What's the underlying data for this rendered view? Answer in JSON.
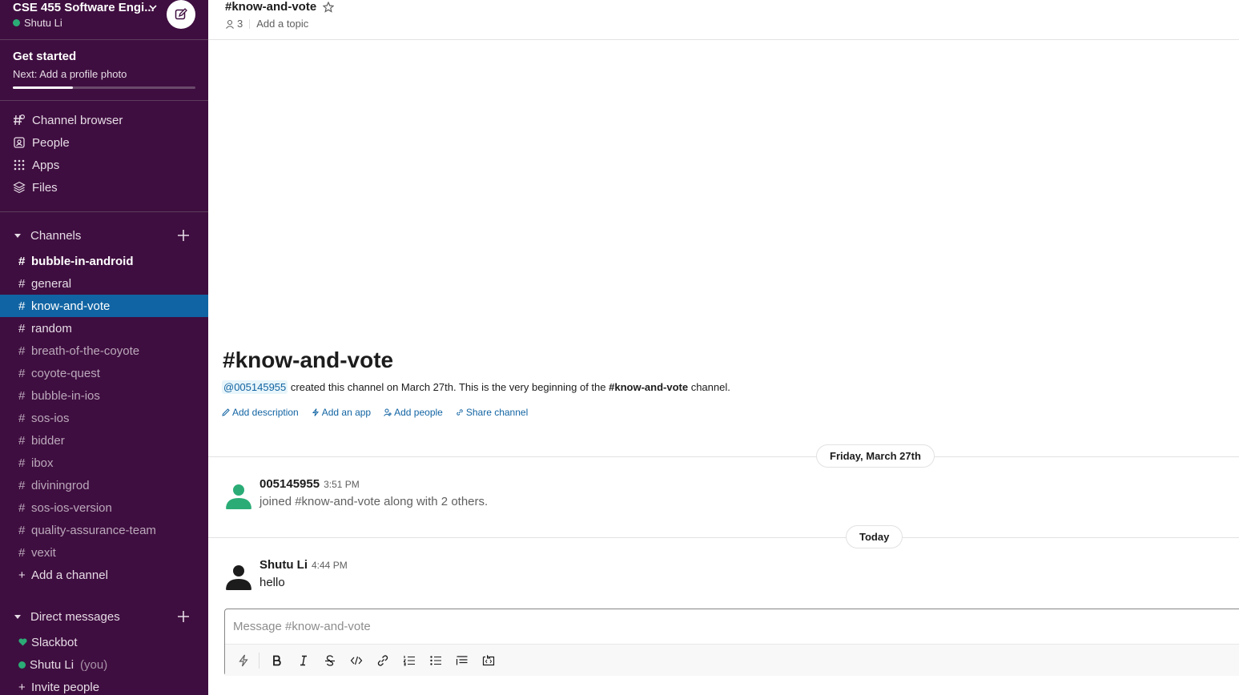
{
  "workspace": {
    "name": "CSE 455 Software Engi...",
    "user": "Shutu Li"
  },
  "onboarding": {
    "title": "Get started",
    "next": "Next: Add a profile photo",
    "progress": 0.33
  },
  "nav": [
    {
      "label": "Channel browser",
      "icon": "channel-browser-icon"
    },
    {
      "label": "People",
      "icon": "people-icon"
    },
    {
      "label": "Apps",
      "icon": "apps-icon"
    },
    {
      "label": "Files",
      "icon": "files-icon"
    }
  ],
  "channels_section": {
    "title": "Channels",
    "items": [
      {
        "name": "bubble-in-android",
        "state": "unread"
      },
      {
        "name": "general",
        "state": "normal"
      },
      {
        "name": "know-and-vote",
        "state": "active"
      },
      {
        "name": "random",
        "state": "normal"
      },
      {
        "name": "breath-of-the-coyote",
        "state": "muted"
      },
      {
        "name": "coyote-quest",
        "state": "muted"
      },
      {
        "name": "bubble-in-ios",
        "state": "muted"
      },
      {
        "name": "sos-ios",
        "state": "muted"
      },
      {
        "name": "bidder",
        "state": "muted"
      },
      {
        "name": "ibox",
        "state": "muted"
      },
      {
        "name": "diviningrod",
        "state": "muted"
      },
      {
        "name": "sos-ios-version",
        "state": "muted"
      },
      {
        "name": "quality-assurance-team",
        "state": "muted"
      },
      {
        "name": "vexit",
        "state": "muted"
      }
    ],
    "add_label": "Add a channel"
  },
  "dm_section": {
    "title": "Direct messages",
    "items": [
      {
        "name": "Slackbot",
        "suffix": ""
      },
      {
        "name": "Shutu Li",
        "suffix": "(you)"
      }
    ],
    "invite_label": "Invite people"
  },
  "channel": {
    "title": "#know-and-vote",
    "member_count": "3",
    "topic_placeholder": "Add a topic"
  },
  "intro": {
    "title": "#know-and-vote",
    "mention": "@005145955",
    "text_before": " created this channel on March 27th. This is the very beginning of the ",
    "channel_bold": "#know-and-vote",
    "text_after": " channel.",
    "actions": [
      "Add description",
      "Add an app",
      "Add people",
      "Share channel"
    ]
  },
  "dividers": {
    "first": "Friday, March 27th",
    "second": "Today"
  },
  "messages": [
    {
      "author": "005145955",
      "time": "3:51 PM",
      "body": "joined #know-and-vote along with 2 others.",
      "avatar_color": "#2bac76"
    },
    {
      "author": "Shutu Li",
      "time": "4:44 PM",
      "body": "hello",
      "avatar_color": "#1d1c1d"
    }
  ],
  "composer": {
    "placeholder": "Message #know-and-vote"
  },
  "colors": {
    "sidebar": "#3f0e40",
    "active": "#1164a3",
    "presence": "#2bac76",
    "link": "#1264a3"
  }
}
